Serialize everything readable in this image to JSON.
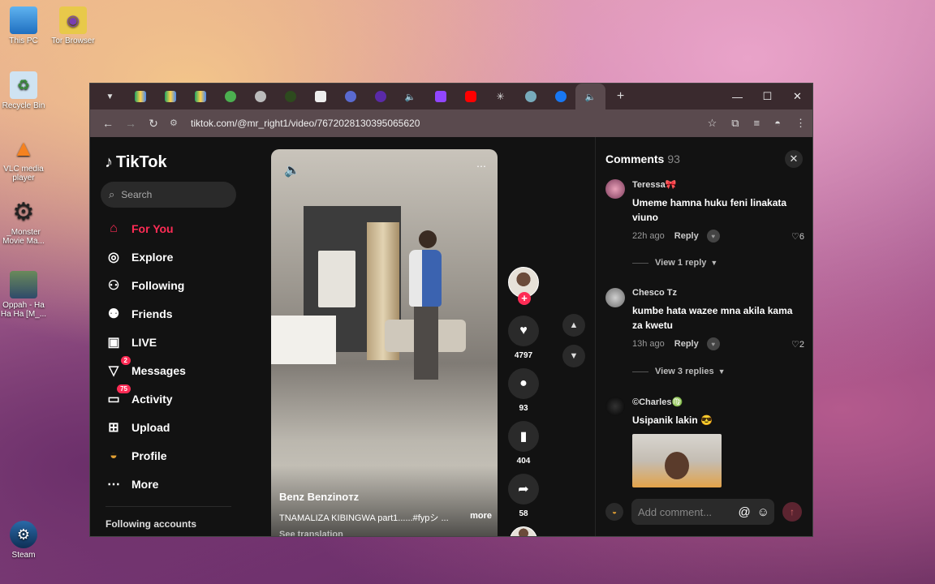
{
  "desktop": {
    "icons": [
      {
        "label": "This PC"
      },
      {
        "label": "Tor Browser"
      },
      {
        "label": "Recycle Bin"
      },
      {
        "label": "VLC media player"
      },
      {
        "label": "_Monster Movie Ma..."
      },
      {
        "label": "Oppah - Ha Ha Ha [M_..."
      },
      {
        "label": "Steam"
      }
    ]
  },
  "browser": {
    "url": "tiktok.com/@mr_right1/video/7672028130395065620",
    "window_controls": {
      "minimize": "—",
      "maximize": "☐",
      "close": "✕"
    }
  },
  "sidebar": {
    "logo": "TikTok",
    "search_placeholder": "Search",
    "items": [
      {
        "label": "For You",
        "icon": "home-icon"
      },
      {
        "label": "Explore",
        "icon": "compass-icon"
      },
      {
        "label": "Following",
        "icon": "user-follow-icon"
      },
      {
        "label": "Friends",
        "icon": "friends-icon"
      },
      {
        "label": "LIVE",
        "icon": "live-icon"
      },
      {
        "label": "Messages",
        "icon": "message-icon",
        "badge": "2"
      },
      {
        "label": "Activity",
        "icon": "activity-icon",
        "badge": "75"
      },
      {
        "label": "Upload",
        "icon": "upload-icon"
      },
      {
        "label": "Profile",
        "icon": "profile-icon"
      },
      {
        "label": "More",
        "icon": "more-icon"
      }
    ],
    "following_accounts": "Following accounts"
  },
  "video": {
    "author": "Benz Benzinoᴛz",
    "caption": "TNAMALIZA KIBINGWA part1......#fypシ ...",
    "more": "more",
    "see_translation": "See translation"
  },
  "actions": {
    "likes": "4797",
    "comments": "93",
    "saves": "404",
    "shares": "58"
  },
  "comments_panel": {
    "title": "Comments",
    "count": "93",
    "comments": [
      {
        "user": "Teressa🎀",
        "text": "Umeme hamna huku feni linakata viuno",
        "time": "22h ago",
        "reply": "Reply",
        "likes": "6",
        "view_replies": "View 1 reply"
      },
      {
        "user": "Chesco Tz",
        "text": "kumbe hata wazee mna akila kama za kwetu",
        "time": "13h ago",
        "reply": "Reply",
        "likes": "2",
        "view_replies": "View 3 replies"
      },
      {
        "user": "©Charles♍",
        "text": "Usipanik lakin 😎"
      }
    ],
    "add_placeholder": "Add comment..."
  },
  "colors": {
    "accent": "#fe2c55",
    "panel_bg": "#121212",
    "tab_bar": "#3a2a2e"
  }
}
